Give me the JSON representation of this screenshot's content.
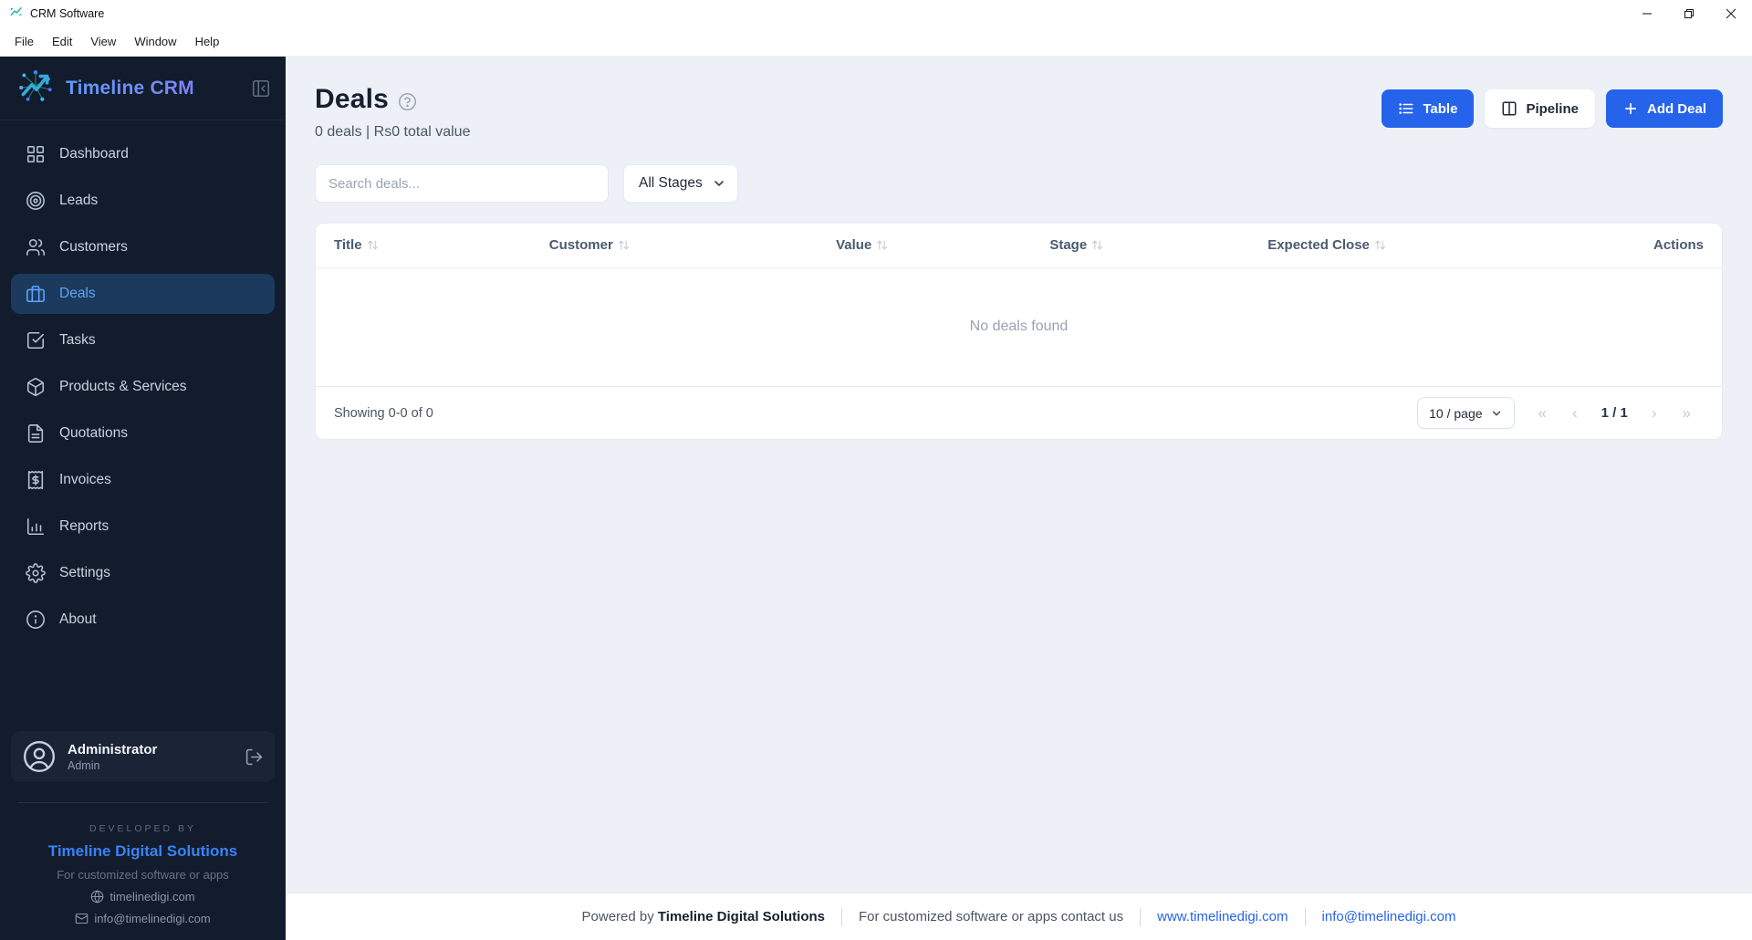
{
  "window": {
    "title": "CRM Software",
    "menu": [
      "File",
      "Edit",
      "View",
      "Window",
      "Help"
    ]
  },
  "sidebar": {
    "brand": "Timeline CRM",
    "nav": [
      {
        "id": "dashboard",
        "label": "Dashboard",
        "icon": "dashboard",
        "active": false
      },
      {
        "id": "leads",
        "label": "Leads",
        "icon": "target",
        "active": false
      },
      {
        "id": "customers",
        "label": "Customers",
        "icon": "users",
        "active": false
      },
      {
        "id": "deals",
        "label": "Deals",
        "icon": "briefcase",
        "active": true
      },
      {
        "id": "tasks",
        "label": "Tasks",
        "icon": "check-square",
        "active": false
      },
      {
        "id": "products-services",
        "label": "Products & Services",
        "icon": "package",
        "active": false
      },
      {
        "id": "quotations",
        "label": "Quotations",
        "icon": "file-text",
        "active": false
      },
      {
        "id": "invoices",
        "label": "Invoices",
        "icon": "receipt",
        "active": false
      },
      {
        "id": "reports",
        "label": "Reports",
        "icon": "bar-chart",
        "active": false
      },
      {
        "id": "settings",
        "label": "Settings",
        "icon": "gear",
        "active": false
      },
      {
        "id": "about",
        "label": "About",
        "icon": "info",
        "active": false
      }
    ],
    "user": {
      "name": "Administrator",
      "role": "Admin"
    },
    "developed_by": {
      "label": "DEVELOPED BY",
      "company": "Timeline Digital Solutions",
      "tagline": "For customized software or apps",
      "website": "timelinedigi.com",
      "email": "info@timelinedigi.com"
    }
  },
  "main": {
    "title": "Deals",
    "subtitle": "0 deals | Rs0 total value",
    "views": {
      "table": "Table",
      "pipeline": "Pipeline",
      "add": "Add Deal"
    },
    "search_placeholder": "Search deals...",
    "stage_filter": "All Stages",
    "table": {
      "columns": [
        {
          "label": "Title",
          "sortable": true
        },
        {
          "label": "Customer",
          "sortable": true
        },
        {
          "label": "Value",
          "sortable": true
        },
        {
          "label": "Stage",
          "sortable": true
        },
        {
          "label": "Expected Close",
          "sortable": true
        },
        {
          "label": "Actions",
          "sortable": false
        }
      ],
      "empty": "No deals found"
    },
    "pagination": {
      "summary": "Showing 0-0 of 0",
      "page_size": "10 / page",
      "page_indicator": "1 / 1",
      "icons": {
        "first": "«",
        "prev": "‹",
        "next": "›",
        "last": "»"
      }
    }
  },
  "footer": {
    "powered_prefix": "Powered by",
    "company": "Timeline Digital Solutions",
    "contact": "For customized software or apps contact us",
    "website": "www.timelinedigi.com",
    "email": "info@timelinedigi.com"
  },
  "colors": {
    "primary": "#2563eb",
    "sidebar_bg": "#121c2c",
    "sidebar_active_bg": "#1c3a5e",
    "sidebar_active_text": "#60a5fa",
    "brand_gradient": [
      "#5e9bf8",
      "#8b7bf7"
    ],
    "link": "#2563eb",
    "main_bg": "#edf1f7"
  }
}
